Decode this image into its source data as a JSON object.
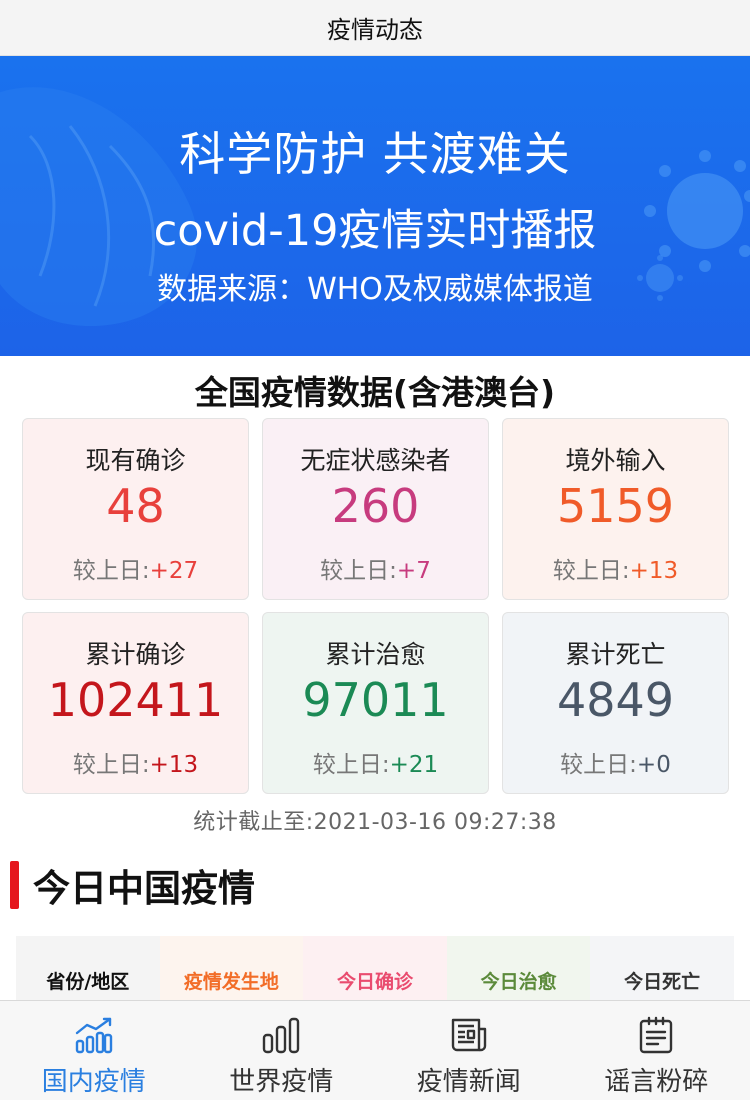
{
  "header": {
    "title": "疫情动态"
  },
  "banner": {
    "line1": "科学防护 共渡难关",
    "line2": "covid-19疫情实时播报",
    "line3": "数据来源：WHO及权威媒体报道"
  },
  "national": {
    "title": "全国疫情数据(含港澳台)",
    "cards": [
      {
        "label": "现有确诊",
        "value": "48",
        "change_label": "较上日:",
        "change": "+27",
        "color": "#e8403c",
        "bg": "#fdf0f0"
      },
      {
        "label": "无症状感染者",
        "value": "260",
        "change_label": "较上日:",
        "change": "+7",
        "color": "#c73b7e",
        "bg": "#faf0f5"
      },
      {
        "label": "境外输入",
        "value": "5159",
        "change_label": "较上日:",
        "change": "+13",
        "color": "#f05b29",
        "bg": "#fdf2ee"
      },
      {
        "label": "累计确诊",
        "value": "102411",
        "change_label": "较上日:",
        "change": "+13",
        "color": "#c4161c",
        "bg": "#fdf0f0"
      },
      {
        "label": "累计治愈",
        "value": "97011",
        "change_label": "较上日:",
        "change": "+21",
        "color": "#1b8a55",
        "bg": "#eef5f1"
      },
      {
        "label": "累计死亡",
        "value": "4849",
        "change_label": "较上日:",
        "change": "+0",
        "color": "#4a5767",
        "bg": "#f1f4f7"
      }
    ],
    "timestamp": "统计截止至:2021-03-16 09:27:38"
  },
  "today": {
    "title": "今日中国疫情"
  },
  "table": {
    "headers": [
      {
        "label": "省份/地区",
        "color": "#111111",
        "bg": "#f4f4f4"
      },
      {
        "label": "疫情发生地",
        "color": "#f26d28",
        "bg": "#fdf4ee"
      },
      {
        "label": "今日确诊",
        "color": "#e94c6f",
        "bg": "#fdf0f2"
      },
      {
        "label": "今日治愈",
        "color": "#5b8a3a",
        "bg": "#f1f6ee"
      },
      {
        "label": "今日死亡",
        "color": "#333333",
        "bg": "#f4f5f7"
      }
    ]
  },
  "tabbar": {
    "active_color": "#2a7fe0",
    "inactive_color": "#333333",
    "tabs": [
      {
        "label": "国内疫情",
        "icon": "trend-chart-icon",
        "active": true
      },
      {
        "label": "世界疫情",
        "icon": "bar-chart-icon",
        "active": false
      },
      {
        "label": "疫情新闻",
        "icon": "newspaper-icon",
        "active": false
      },
      {
        "label": "谣言粉碎",
        "icon": "notepad-icon",
        "active": false
      }
    ]
  }
}
